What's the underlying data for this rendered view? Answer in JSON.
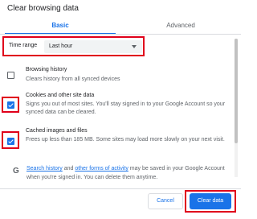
{
  "dialog": {
    "title": "Clear browsing data"
  },
  "tabs": [
    {
      "label": "Basic",
      "active": true
    },
    {
      "label": "Advanced",
      "active": false
    }
  ],
  "time_range": {
    "label": "Time range",
    "value": "Last hour"
  },
  "options": [
    {
      "title": "Browsing history",
      "description": "Clears history from all synced devices",
      "checked": false
    },
    {
      "title": "Cookies and other site data",
      "description": "Signs you out of most sites. You'll stay signed in to your Google Account so your synced data can be cleared.",
      "checked": true
    },
    {
      "title": "Cached images and files",
      "description": "Frees up less than 185 MB. Some sites may load more slowly on your next visit.",
      "checked": true
    }
  ],
  "info": {
    "link1": "Search history",
    "text1": " and ",
    "link2": "other forms of activity",
    "text2": " may be saved in your Google Account when you're signed in. You can delete them anytime."
  },
  "buttons": {
    "cancel": "Cancel",
    "clear": "Clear data"
  },
  "colors": {
    "accent": "#1a73e8",
    "highlight": "#e0001b"
  }
}
